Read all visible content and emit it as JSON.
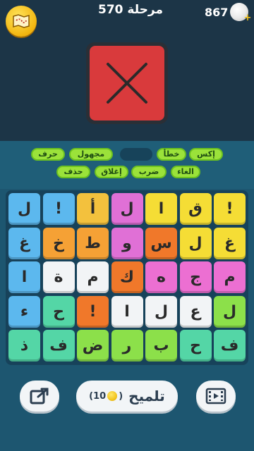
{
  "header": {
    "level_label": "مرحلة 570",
    "coins_count": "867",
    "map_icon": "map-icon",
    "coin_icon": "coin-icon"
  },
  "picture": {
    "icon": "x-mark-icon",
    "background": "#d93a3c"
  },
  "answers": {
    "row1": [
      "إكس",
      "خطأ",
      "مجهول",
      "حرف"
    ],
    "row2": [
      "الغاء",
      "ضرب",
      "إغلاق",
      "حذف"
    ]
  },
  "grid": {
    "rows": [
      [
        "ل",
        "!",
        "أ",
        "ل",
        "ا",
        "ق",
        "!"
      ],
      [
        "غ",
        "خ",
        "ط",
        "و",
        "س",
        "ل",
        "غ"
      ],
      [
        "ا",
        "ة",
        "م",
        "ك",
        "ه",
        "ج",
        "م"
      ],
      [
        "ء",
        "ح",
        "!",
        "ا",
        "ل",
        "ع",
        "ل"
      ],
      [
        "ذ",
        "ف",
        "ض",
        "ر",
        "ب",
        "ح",
        "ف"
      ]
    ],
    "colors": [
      [
        "#5cb8ee",
        "#5cb8ee",
        "#f3c13d",
        "#e070d6",
        "#f5dd35",
        "#f5dd35",
        "#f5dd35"
      ],
      [
        "#5cb8ee",
        "#f5a135",
        "#f5a135",
        "#e070d6",
        "#f0782a",
        "#f5dd35",
        "#f5dd35"
      ],
      [
        "#5cb8ee",
        "#f2f4f6",
        "#f2f4f6",
        "#f0782a",
        "#ec6fd2",
        "#ec6fd2",
        "#ec6fd2"
      ],
      [
        "#5cb8ee",
        "#54d6a6",
        "#f0782a",
        "#f2f4f6",
        "#f2f4f6",
        "#f2f4f6",
        "#8ce04a"
      ],
      [
        "#54d6a6",
        "#54d6a6",
        "#8ce04a",
        "#8ce04a",
        "#8ce04a",
        "#54d6a6",
        "#54d6a6"
      ]
    ]
  },
  "footer": {
    "share_icon": "share-icon",
    "hint_label": "تلميح",
    "hint_cost_open": "(",
    "hint_cost": "10",
    "hint_cost_close": ")",
    "video_icon": "video-icon"
  }
}
